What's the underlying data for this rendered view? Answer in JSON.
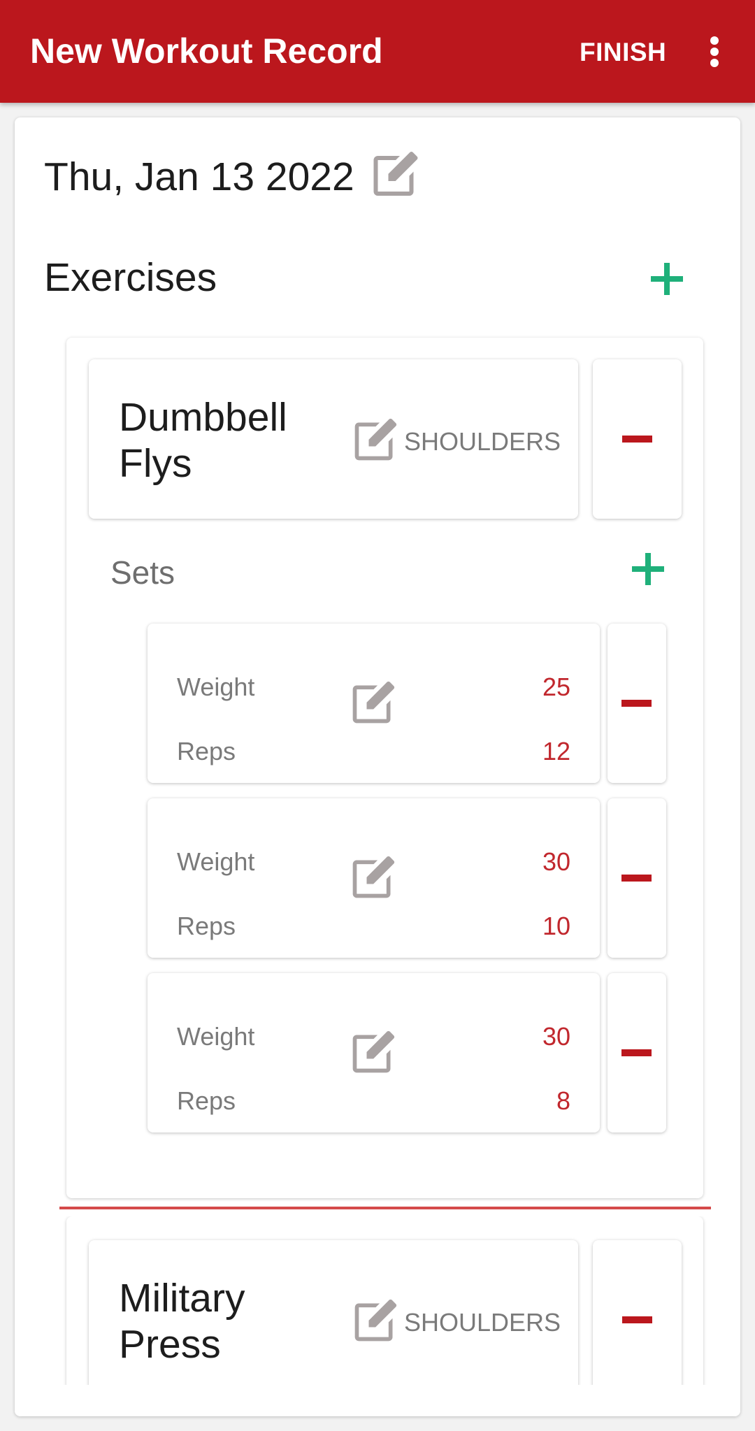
{
  "appbar": {
    "title": "New Workout Record",
    "finish_label": "FINISH",
    "menu_icon": "more-vert-icon",
    "background": "#bb171d"
  },
  "record": {
    "date": "Thu, Jan 13 2022",
    "edit_icon": "edit-icon"
  },
  "exercises": {
    "title": "Exercises",
    "add_icon": "plus-icon",
    "items": [
      {
        "name": "Dumbbell Flys",
        "muscle_group": "SHOULDERS",
        "sets_label": "Sets",
        "sets": [
          {
            "weight_label": "Weight",
            "weight": "25",
            "reps_label": "Reps",
            "reps": "12"
          },
          {
            "weight_label": "Weight",
            "weight": "30",
            "reps_label": "Reps",
            "reps": "10"
          },
          {
            "weight_label": "Weight",
            "weight": "30",
            "reps_label": "Reps",
            "reps": "8"
          }
        ]
      },
      {
        "name": "Military Press",
        "muscle_group": "SHOULDERS"
      }
    ]
  },
  "colors": {
    "accent_red": "#bb171d",
    "value_red": "#c1272d",
    "add_green": "#1fb07a",
    "icon_gray": "#a8a2a2"
  }
}
